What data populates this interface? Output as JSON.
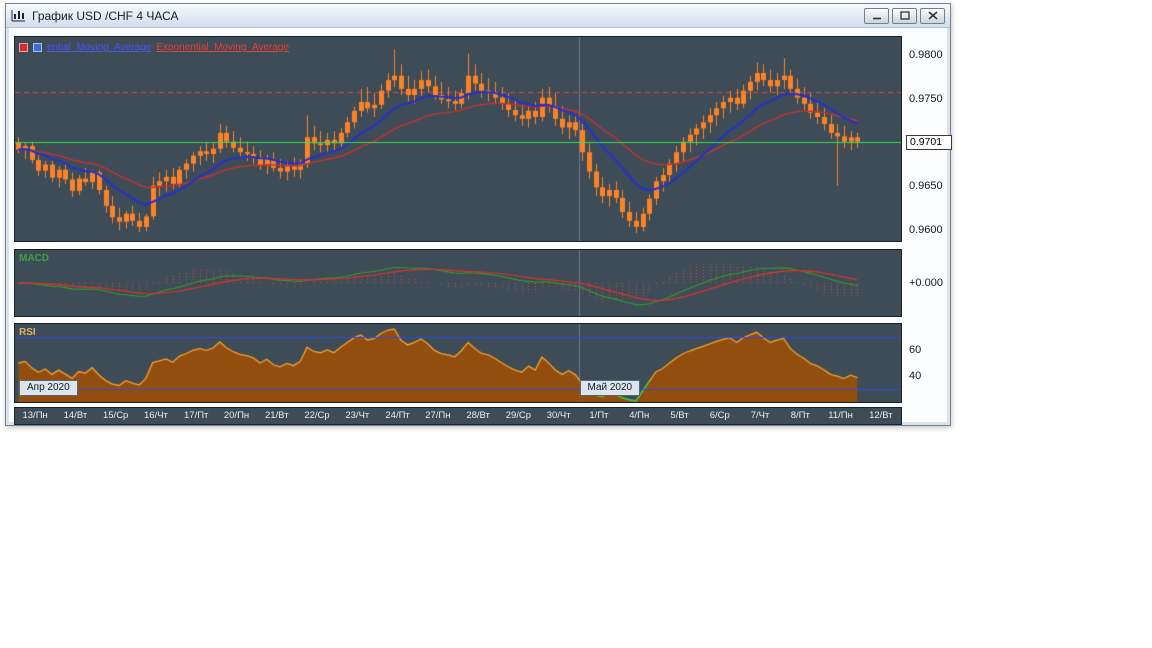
{
  "window": {
    "title": "График USD /CHF 4 ЧАСА"
  },
  "legend": {
    "ema1_label": "ential_Moving_Average",
    "ema2_label": "Exponential_Moving_Average",
    "ema1_color": "#2431cf",
    "ema2_color": "#c93030"
  },
  "panels": {
    "macd_label": "MACD",
    "rsi_label": "RSI"
  },
  "badges": {
    "april": "Апр 2020",
    "may": "Май 2020"
  },
  "axis": {
    "price_ticks": [
      "0.9800",
      "0.9750",
      "0.9700",
      "0.9650",
      "0.9600"
    ],
    "price_tag": "0.9701",
    "macd_zero_label": "+0.000",
    "rsi_ticks": [
      "60",
      "40"
    ],
    "x_labels": [
      "13/Пн",
      "14/Вт",
      "15/Ср",
      "16/Чт",
      "17/Пт",
      "20/Пн",
      "21/Вт",
      "22/Ср",
      "23/Чт",
      "24/Пт",
      "27/Пн",
      "28/Вт",
      "29/Ср",
      "30/Чт",
      "1/Пт",
      "4/Пн",
      "5/Вт",
      "6/Ср",
      "7/Чт",
      "8/Пт",
      "11/Пн",
      "12/Вт"
    ]
  },
  "chart_data": [
    {
      "type": "candlestick",
      "symbol": "USD/CHF",
      "timeframe": "4 ЧАСА",
      "scale": 0.0001,
      "total_slots": 132,
      "month_boundary_index": 84,
      "ylim": [
        0.9588,
        0.982
      ],
      "y_ticks": [
        0.98,
        0.975,
        0.97,
        0.965,
        0.96
      ],
      "candle_color": "#ff8226",
      "levels": {
        "resistance": 0.9757,
        "resistance_color": "#e04040",
        "current": 0.9701,
        "current_color": "#30e050"
      },
      "overlays": [
        {
          "name": "Exponential_Moving_Average",
          "period": 26,
          "color": "#c93030",
          "width": 1.4
        },
        {
          "name": "Exponential_Moving_Average",
          "period": 12,
          "color": "#2431cf",
          "width": 2
        }
      ],
      "candles": [
        [
          9700,
          9706,
          9688,
          9692
        ],
        [
          9692,
          9699,
          9681,
          9696
        ],
        [
          9696,
          9701,
          9676,
          9680
        ],
        [
          9680,
          9686,
          9662,
          9668
        ],
        [
          9668,
          9679,
          9660,
          9675
        ],
        [
          9675,
          9679,
          9655,
          9660
        ],
        [
          9660,
          9673,
          9649,
          9669
        ],
        [
          9669,
          9676,
          9653,
          9658
        ],
        [
          9658,
          9666,
          9638,
          9645
        ],
        [
          9645,
          9663,
          9640,
          9659
        ],
        [
          9659,
          9671,
          9651,
          9655
        ],
        [
          9655,
          9669,
          9647,
          9666
        ],
        [
          9666,
          9669,
          9641,
          9646
        ],
        [
          9646,
          9651,
          9620,
          9628
        ],
        [
          9628,
          9639,
          9608,
          9615
        ],
        [
          9615,
          9626,
          9600,
          9610
        ],
        [
          9610,
          9622,
          9602,
          9619
        ],
        [
          9619,
          9628,
          9605,
          9611
        ],
        [
          9611,
          9620,
          9598,
          9604
        ],
        [
          9604,
          9619,
          9599,
          9616
        ],
        [
          9616,
          9661,
          9612,
          9651
        ],
        [
          9651,
          9666,
          9639,
          9656
        ],
        [
          9656,
          9669,
          9644,
          9661
        ],
        [
          9661,
          9671,
          9647,
          9653
        ],
        [
          9653,
          9673,
          9649,
          9669
        ],
        [
          9669,
          9681,
          9659,
          9676
        ],
        [
          9676,
          9689,
          9667,
          9685
        ],
        [
          9685,
          9696,
          9674,
          9690
        ],
        [
          9690,
          9701,
          9679,
          9687
        ],
        [
          9687,
          9699,
          9677,
          9693
        ],
        [
          9693,
          9721,
          9688,
          9711
        ],
        [
          9711,
          9719,
          9694,
          9701
        ],
        [
          9701,
          9713,
          9689,
          9694
        ],
        [
          9694,
          9706,
          9684,
          9689
        ],
        [
          9689,
          9701,
          9679,
          9687
        ],
        [
          9687,
          9696,
          9676,
          9683
        ],
        [
          9683,
          9691,
          9669,
          9674
        ],
        [
          9674,
          9686,
          9664,
          9681
        ],
        [
          9681,
          9689,
          9667,
          9671
        ],
        [
          9671,
          9681,
          9659,
          9667
        ],
        [
          9667,
          9679,
          9657,
          9673
        ],
        [
          9673,
          9683,
          9661,
          9669
        ],
        [
          9669,
          9681,
          9659,
          9676
        ],
        [
          9676,
          9731,
          9671,
          9706
        ],
        [
          9706,
          9719,
          9691,
          9699
        ],
        [
          9699,
          9713,
          9689,
          9697
        ],
        [
          9697,
          9711,
          9687,
          9703
        ],
        [
          9703,
          9713,
          9691,
          9699
        ],
        [
          9699,
          9716,
          9694,
          9711
        ],
        [
          9711,
          9729,
          9706,
          9723
        ],
        [
          9723,
          9741,
          9716,
          9736
        ],
        [
          9736,
          9761,
          9729,
          9746
        ],
        [
          9746,
          9763,
          9734,
          9739
        ],
        [
          9739,
          9756,
          9729,
          9743
        ],
        [
          9743,
          9766,
          9738,
          9759
        ],
        [
          9759,
          9779,
          9751,
          9771
        ],
        [
          9771,
          9806,
          9763,
          9776
        ],
        [
          9776,
          9789,
          9754,
          9761
        ],
        [
          9761,
          9776,
          9747,
          9754
        ],
        [
          9754,
          9771,
          9744,
          9761
        ],
        [
          9761,
          9781,
          9753,
          9771
        ],
        [
          9771,
          9783,
          9757,
          9764
        ],
        [
          9764,
          9776,
          9749,
          9754
        ],
        [
          9754,
          9769,
          9744,
          9749
        ],
        [
          9749,
          9763,
          9739,
          9747
        ],
        [
          9747,
          9759,
          9737,
          9744
        ],
        [
          9744,
          9761,
          9739,
          9756
        ],
        [
          9756,
          9801,
          9749,
          9776
        ],
        [
          9776,
          9789,
          9759,
          9767
        ],
        [
          9767,
          9779,
          9751,
          9759
        ],
        [
          9759,
          9773,
          9747,
          9757
        ],
        [
          9757,
          9769,
          9744,
          9751
        ],
        [
          9751,
          9763,
          9737,
          9744
        ],
        [
          9744,
          9756,
          9729,
          9737
        ],
        [
          9737,
          9749,
          9724,
          9731
        ],
        [
          9731,
          9743,
          9719,
          9727
        ],
        [
          9727,
          9741,
          9717,
          9736
        ],
        [
          9736,
          9746,
          9721,
          9729
        ],
        [
          9729,
          9761,
          9724,
          9751
        ],
        [
          9751,
          9763,
          9734,
          9741
        ],
        [
          9741,
          9756,
          9719,
          9727
        ],
        [
          9727,
          9741,
          9709,
          9717
        ],
        [
          9717,
          9731,
          9704,
          9723
        ],
        [
          9723,
          9733,
          9707,
          9714
        ],
        [
          9714,
          9721,
          9679,
          9689
        ],
        [
          9689,
          9699,
          9659,
          9667
        ],
        [
          9667,
          9676,
          9639,
          9649
        ],
        [
          9649,
          9661,
          9631,
          9639
        ],
        [
          9639,
          9653,
          9627,
          9646
        ],
        [
          9646,
          9656,
          9631,
          9637
        ],
        [
          9637,
          9646,
          9614,
          9621
        ],
        [
          9621,
          9633,
          9604,
          9611
        ],
        [
          9611,
          9621,
          9597,
          9604
        ],
        [
          9604,
          9626,
          9599,
          9619
        ],
        [
          9619,
          9641,
          9611,
          9636
        ],
        [
          9636,
          9661,
          9629,
          9656
        ],
        [
          9656,
          9671,
          9644,
          9663
        ],
        [
          9663,
          9681,
          9654,
          9676
        ],
        [
          9676,
          9696,
          9667,
          9689
        ],
        [
          9689,
          9706,
          9679,
          9701
        ],
        [
          9701,
          9716,
          9689,
          9709
        ],
        [
          9709,
          9721,
          9697,
          9716
        ],
        [
          9716,
          9731,
          9704,
          9723
        ],
        [
          9723,
          9739,
          9711,
          9731
        ],
        [
          9731,
          9746,
          9719,
          9739
        ],
        [
          9739,
          9753,
          9727,
          9746
        ],
        [
          9746,
          9759,
          9734,
          9751
        ],
        [
          9751,
          9761,
          9737,
          9744
        ],
        [
          9744,
          9766,
          9739,
          9759
        ],
        [
          9759,
          9776,
          9749,
          9769
        ],
        [
          9769,
          9791,
          9759,
          9779
        ],
        [
          9779,
          9789,
          9764,
          9771
        ],
        [
          9771,
          9783,
          9757,
          9764
        ],
        [
          9764,
          9779,
          9754,
          9771
        ],
        [
          9771,
          9796,
          9761,
          9776
        ],
        [
          9776,
          9783,
          9754,
          9761
        ],
        [
          9761,
          9773,
          9744,
          9751
        ],
        [
          9751,
          9763,
          9737,
          9744
        ],
        [
          9744,
          9756,
          9727,
          9734
        ],
        [
          9734,
          9746,
          9721,
          9729
        ],
        [
          9729,
          9739,
          9714,
          9721
        ],
        [
          9721,
          9731,
          9704,
          9711
        ],
        [
          9711,
          9721,
          9651,
          9707
        ],
        [
          9707,
          9719,
          9694,
          9701
        ],
        [
          9701,
          9713,
          9691,
          9706
        ],
        [
          9706,
          9711,
          9694,
          9701
        ]
      ]
    },
    {
      "type": "macd",
      "fast": 12,
      "slow": 26,
      "signal_period": 9,
      "ylim": [
        -0.005,
        0.005
      ],
      "zero_label": "+0.000",
      "hist_scale": 2.5,
      "macd_color": "#2f9e2f",
      "signal_color": "#cf3333",
      "hist_color": "#e04444"
    },
    {
      "type": "rsi",
      "period": 14,
      "seed": 50,
      "ylim": [
        20,
        80
      ],
      "bands": [
        30,
        70
      ],
      "ticks": [
        60,
        40
      ],
      "line_color": "#f7a02a",
      "fill_color": "rgba(158,79,6,0.88)",
      "oversold_color": "#1fcf46",
      "band_color": "#2f4ae0"
    }
  ]
}
